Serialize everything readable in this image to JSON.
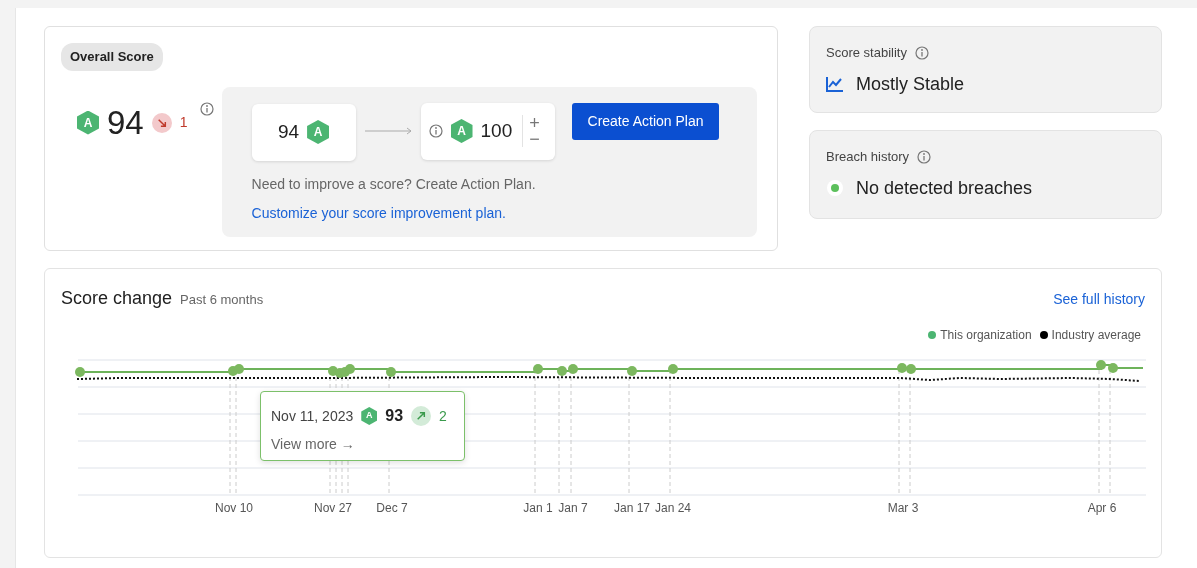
{
  "overall_score": {
    "label": "Overall Score",
    "grade": "A",
    "score": "94",
    "rising": false,
    "change": "1"
  },
  "planner": {
    "current_score": "94",
    "current_grade": "A",
    "target_grade": "A",
    "target_score": "100",
    "plus": "+",
    "minus": "−",
    "button": "Create Action Plan",
    "hint": "Need to improve a score? Create Action Plan.",
    "link": "Customize your score improvement plan."
  },
  "stability": {
    "title": "Score stability",
    "value": "Mostly Stable"
  },
  "breach": {
    "title": "Breach history",
    "value": "No detected breaches"
  },
  "score_change": {
    "title": "Score change",
    "subtitle": "Past 6 months",
    "link": "See full history",
    "legend": [
      {
        "label": "This organization",
        "color": "#4cb572"
      },
      {
        "label": "Industry average",
        "color": "#000000"
      }
    ],
    "x_labels": [
      "Nov 10",
      "Nov 27",
      "Dec 7",
      "Jan 1",
      "Jan 7",
      "Jan 17",
      "Jan 24",
      "Mar 3",
      "Apr 6"
    ],
    "tooltip": {
      "date": "Nov 11, 2023",
      "grade": "A",
      "score": "93",
      "rising": true,
      "change": "2",
      "link": "View more →"
    }
  }
}
